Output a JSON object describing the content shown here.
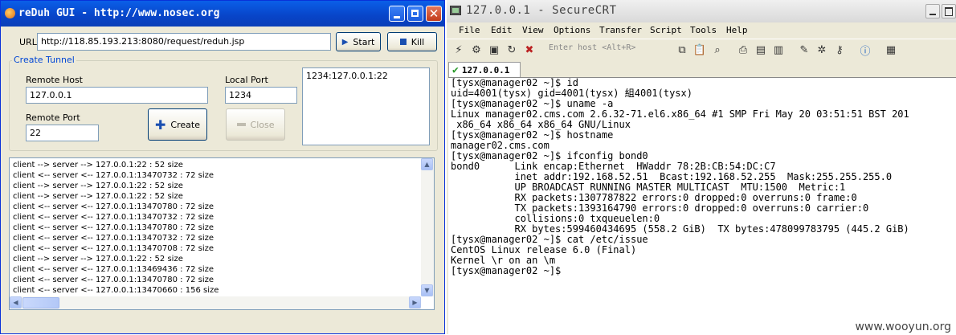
{
  "left_window": {
    "title": "reDuh GUI - http://www.nosec.org",
    "url_label": "URL",
    "url_value": "http://118.85.193.213:8080/request/reduh.jsp",
    "start_label": "Start",
    "kill_label": "Kill",
    "group_title": "Create Tunnel",
    "remote_host_label": "Remote Host",
    "remote_host_value": "127.0.0.1",
    "local_port_label": "Local Port",
    "local_port_value": "1234",
    "remote_port_label": "Remote Port",
    "remote_port_value": "22",
    "create_label": "Create",
    "close_label": "Close",
    "tunnel_list": [
      "1234:127.0.0.1:22"
    ],
    "log": [
      "client --> server --> 127.0.0.1:22 : 52 size",
      "client <-- server <-- 127.0.0.1:13470732 : 72 size",
      "client --> server --> 127.0.0.1:22 : 52 size",
      "client --> server --> 127.0.0.1:22 : 52 size",
      "client <-- server <-- 127.0.0.1:13470780 : 72 size",
      "client <-- server <-- 127.0.0.1:13470732 : 72 size",
      "client <-- server <-- 127.0.0.1:13470780 : 72 size",
      "client <-- server <-- 127.0.0.1:13470732 : 72 size",
      "client <-- server <-- 127.0.0.1:13470708 : 72 size",
      "client --> server --> 127.0.0.1:22 : 52 size",
      "client <-- server <-- 127.0.0.1:13469436 : 72 size",
      "client <-- server <-- 127.0.0.1:13470780 : 72 size",
      "client <-- server <-- 127.0.0.1:13470660 : 156 size"
    ]
  },
  "right_window": {
    "title": "127.0.0.1 - SecureCRT",
    "menu": [
      "File",
      "Edit",
      "View",
      "Options",
      "Transfer",
      "Script",
      "Tools",
      "Help"
    ],
    "enter_host_placeholder": "Enter host <Alt+R>",
    "tab_label": "127.0.0.1",
    "terminal_lines": [
      "[tysx@manager02 ~]$ id",
      "uid=4001(tysx) gid=4001(tysx) 組4001(tysx)",
      "[tysx@manager02 ~]$ uname -a",
      "Linux manager02.cms.com 2.6.32-71.el6.x86_64 #1 SMP Fri May 20 03:51:51 BST 201",
      " x86_64 x86_64 x86_64 GNU/Linux",
      "[tysx@manager02 ~]$ hostname",
      "manager02.cms.com",
      "[tysx@manager02 ~]$ ifconfig bond0",
      "bond0      Link encap:Ethernet  HWaddr 78:2B:CB:54:DC:C7",
      "           inet addr:192.168.52.51  Bcast:192.168.52.255  Mask:255.255.255.0",
      "           UP BROADCAST RUNNING MASTER MULTICAST  MTU:1500  Metric:1",
      "           RX packets:1307787822 errors:0 dropped:0 overruns:0 frame:0",
      "           TX packets:1393164790 errors:0 dropped:0 overruns:0 carrier:0",
      "           collisions:0 txqueuelen:0",
      "           RX bytes:599460434695 (558.2 GiB)  TX bytes:478099783795 (445.2 GiB)",
      "",
      "[tysx@manager02 ~]$ cat /etc/issue",
      "CentOS Linux release 6.0 (Final)",
      "Kernel \\r on an \\m",
      "",
      "[tysx@manager02 ~]$ "
    ]
  },
  "watermark": "www.wooyun.org"
}
